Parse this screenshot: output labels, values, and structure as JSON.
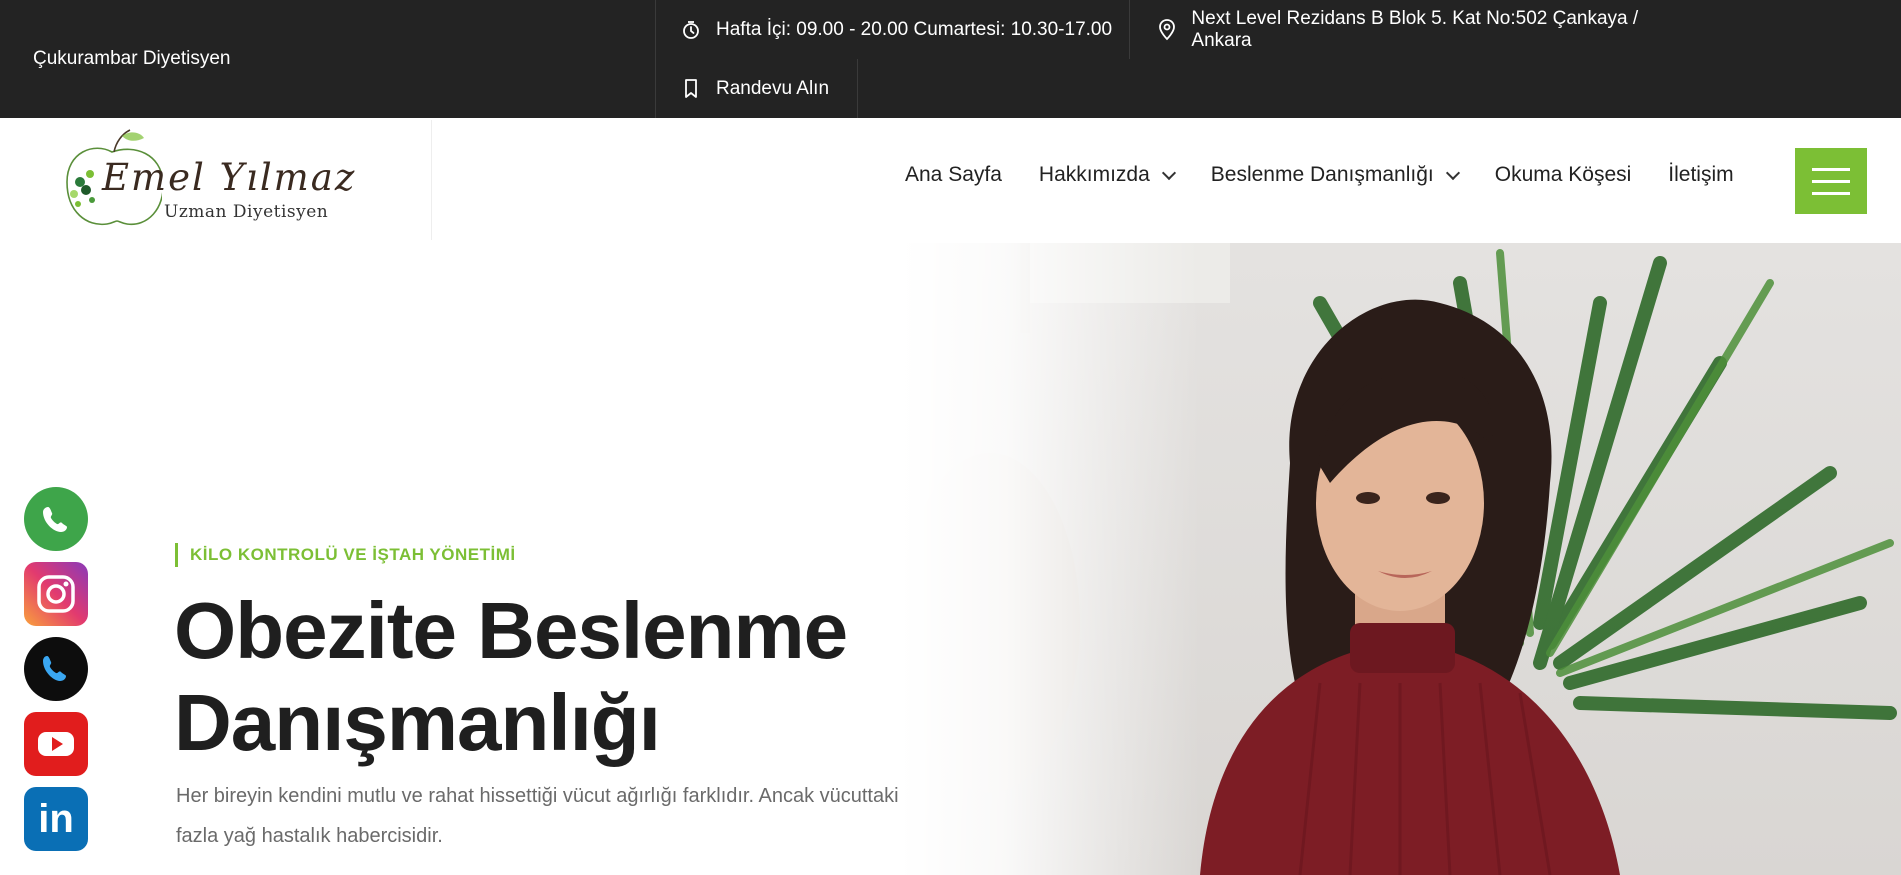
{
  "topbar": {
    "brand": "Çukurambar Diyetisyen",
    "hours": "Hafta İçi: 09.00 - 20.00 Cumartesi: 10.30-17.00",
    "address": "Next Level Rezidans B Blok 5. Kat No:502 Çankaya / Ankara",
    "appointment": "Randevu Alın",
    "icons": [
      "clock-icon",
      "location-pin-icon",
      "bookmark-icon"
    ]
  },
  "logo": {
    "name": "Emel Yılmaz",
    "subtitle": "Uzman Diyetisyen"
  },
  "nav": {
    "items": [
      {
        "label": "Ana Sayfa",
        "dropdown": false
      },
      {
        "label": "Hakkımızda",
        "dropdown": true
      },
      {
        "label": "Beslenme Danışmanlığı",
        "dropdown": true
      },
      {
        "label": "Okuma Köşesi",
        "dropdown": false
      },
      {
        "label": "İletişim",
        "dropdown": false
      }
    ],
    "menu_button_color": "#7cbf35"
  },
  "hero": {
    "kicker": "KİLO KONTROLÜ VE İŞTAH YÖNETİMİ",
    "title_line1": "Obezite Beslenme",
    "title_line2": "Danışmanlığı",
    "description": "Her bireyin kendini mutlu ve rahat hissettiği vücut ağırlığı farklıdır. Ancak vücuttaki fazla yağ hastalık habercisidir."
  },
  "social": [
    "whatsapp-icon",
    "instagram-icon",
    "phone-icon",
    "youtube-icon",
    "linkedin-icon"
  ],
  "colors": {
    "accent": "#7cbf35",
    "topbar_bg": "#232323"
  }
}
